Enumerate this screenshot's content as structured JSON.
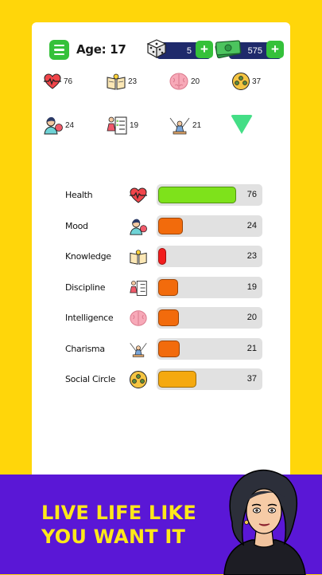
{
  "header": {
    "age_text": "Age: 17",
    "dice_count": "5",
    "money": "575"
  },
  "quick_stats": [
    {
      "icon": "heart-pulse-icon",
      "value": "76"
    },
    {
      "icon": "open-book-icon",
      "value": "23"
    },
    {
      "icon": "brain-icon",
      "value": "20"
    },
    {
      "icon": "social-circle-icon",
      "value": "37"
    },
    {
      "icon": "mood-person-icon",
      "value": "24"
    },
    {
      "icon": "checklist-icon",
      "value": "19"
    },
    {
      "icon": "spotlight-icon",
      "value": "21"
    }
  ],
  "stats": [
    {
      "label": "Health",
      "icon": "heart-pulse-icon",
      "value": "76",
      "level": 0.76,
      "color": "#7ee21b"
    },
    {
      "label": "Mood",
      "icon": "mood-person-icon",
      "value": "24",
      "level": 0.24,
      "color": "#f26b0c"
    },
    {
      "label": "Knowledge",
      "icon": "open-book-icon",
      "value": "23",
      "level": 0.05,
      "color": "#f21d1d"
    },
    {
      "label": "Discipline",
      "icon": "checklist-icon",
      "value": "19",
      "level": 0.19,
      "color": "#f26b0c"
    },
    {
      "label": "Intelligence",
      "icon": "brain-icon",
      "value": "20",
      "level": 0.2,
      "color": "#f26b0c"
    },
    {
      "label": "Charisma",
      "icon": "spotlight-icon",
      "value": "21",
      "level": 0.21,
      "color": "#f26b0c"
    },
    {
      "label": "Social Circle",
      "icon": "social-circle-icon",
      "value": "37",
      "level": 0.37,
      "color": "#f5a90f"
    }
  ],
  "banner": {
    "line1": "LIVE LIFE LIKE",
    "line2": "YOU WANT IT"
  },
  "colors": {
    "background": "#ffd60a",
    "banner": "#5a17d6",
    "accent_green": "#35c13a",
    "pill": "#1f2a6b",
    "slogan": "#ffe81a"
  }
}
